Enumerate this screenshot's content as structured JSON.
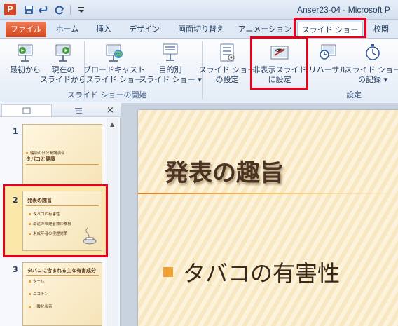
{
  "titlebar": {
    "app_icon": "P",
    "window_title": "Anser23-04 - Microsoft P",
    "qat": [
      "save-icon",
      "undo-icon",
      "redo-icon",
      "customize-icon"
    ]
  },
  "tabs": [
    {
      "label": "ファイル",
      "name": "tab-file"
    },
    {
      "label": "ホーム",
      "name": "tab-home"
    },
    {
      "label": "挿入",
      "name": "tab-insert"
    },
    {
      "label": "デザイン",
      "name": "tab-design"
    },
    {
      "label": "画面切り替え",
      "name": "tab-transitions"
    },
    {
      "label": "アニメーション",
      "name": "tab-animations"
    },
    {
      "label": "スライド ショー",
      "name": "tab-slideshow",
      "active": true
    },
    {
      "label": "校閲",
      "name": "tab-review"
    }
  ],
  "ribbon": {
    "groups": [
      {
        "label": "スライド ショーの開始"
      },
      {
        "label": "設定"
      }
    ],
    "buttons": [
      {
        "line1": "最初から",
        "line2": ""
      },
      {
        "line1": "現在の",
        "line2": "スライドから"
      },
      {
        "line1": "ブロードキャスト",
        "line2": "スライド ショー"
      },
      {
        "line1": "目的別",
        "line2": "スライド ショー ▾"
      },
      {
        "line1": "スライド ショー",
        "line2": "の設定"
      },
      {
        "line1": "非表示スライド",
        "line2": "に設定"
      },
      {
        "line1": "リハーサル",
        "line2": ""
      },
      {
        "line1": "スライド ショー",
        "line2": "の記録 ▾"
      }
    ]
  },
  "slides_pane": {
    "close": "×",
    "thumbnails": [
      {
        "number": "1",
        "title": "タバコと健康",
        "subtitle": "健康の日公開講演会"
      },
      {
        "number": "2",
        "title": "発表の趣旨",
        "bullets": [
          "タバコの有害性",
          "最近の喫煙者数の推移",
          "未成年者の喫煙対策"
        ]
      },
      {
        "number": "3",
        "title": "タバコに含まれる主な有害成分",
        "bullets": [
          "タール",
          "ニコチン",
          "一酸化炭素"
        ]
      }
    ]
  },
  "slide": {
    "title": "発表の趣旨",
    "bullet": "タバコの有害性"
  },
  "colors": {
    "highlight": "#e8001c",
    "file_tab": "#d1461c",
    "accent_bullet": "#f0a030"
  }
}
